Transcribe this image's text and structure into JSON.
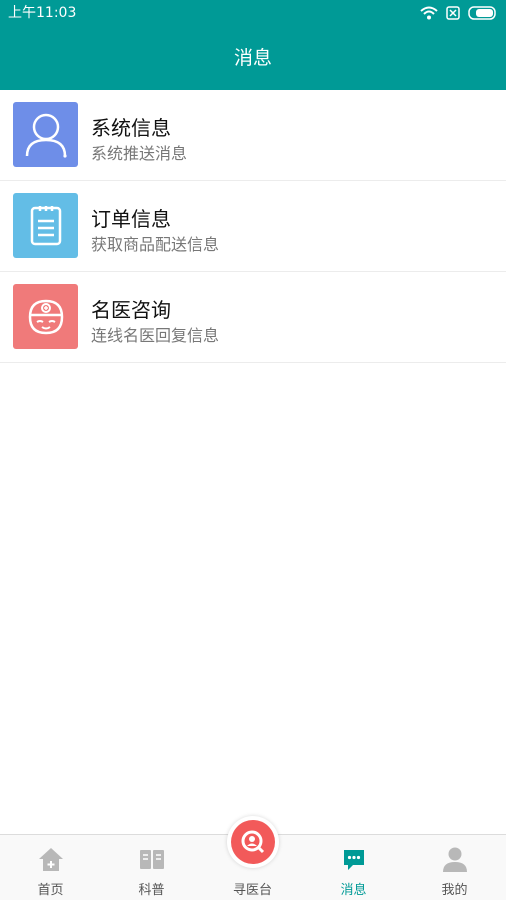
{
  "status_bar": {
    "time": "上午11:03"
  },
  "header": {
    "title": "消息"
  },
  "colors": {
    "primary": "#009a96",
    "system_icon_bg": "#6e8ee8",
    "order_icon_bg": "#63bde6",
    "consult_icon_bg": "#f07a7a",
    "center_tab_bg": "#f25a5a"
  },
  "messages": [
    {
      "title": "系统信息",
      "subtitle": "系统推送消息",
      "icon": "user-icon"
    },
    {
      "title": "订单信息",
      "subtitle": "获取商品配送信息",
      "icon": "clipboard-icon"
    },
    {
      "title": "名医咨询",
      "subtitle": "连线名医回复信息",
      "icon": "nurse-icon"
    }
  ],
  "tabbar": {
    "items": [
      {
        "label": "首页",
        "icon": "home-icon"
      },
      {
        "label": "科普",
        "icon": "book-icon"
      },
      {
        "label": "寻医台",
        "icon": "search-doctor-icon"
      },
      {
        "label": "消息",
        "icon": "chat-icon",
        "active": true
      },
      {
        "label": "我的",
        "icon": "profile-icon"
      }
    ]
  }
}
